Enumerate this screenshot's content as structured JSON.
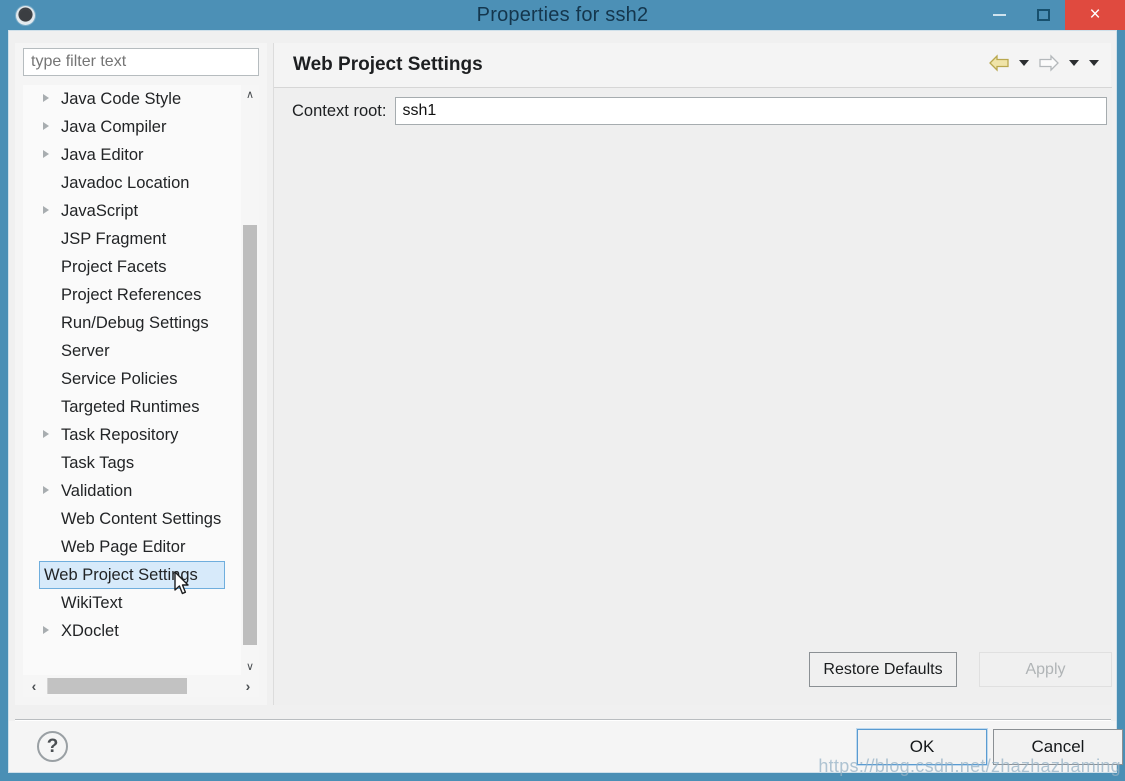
{
  "window": {
    "title": "Properties for ssh2",
    "app_icon": "gear-icon",
    "controls": {
      "minimize": "–",
      "maximize": "□",
      "close": "×"
    }
  },
  "sidebar": {
    "filter_placeholder": "type filter text",
    "filter_value": "",
    "items": [
      {
        "label": "Java Code Style",
        "expandable": true
      },
      {
        "label": "Java Compiler",
        "expandable": true
      },
      {
        "label": "Java Editor",
        "expandable": true
      },
      {
        "label": "Javadoc Location",
        "expandable": false
      },
      {
        "label": "JavaScript",
        "expandable": true
      },
      {
        "label": "JSP Fragment",
        "expandable": false
      },
      {
        "label": "Project Facets",
        "expandable": false
      },
      {
        "label": "Project References",
        "expandable": false
      },
      {
        "label": "Run/Debug Settings",
        "expandable": false
      },
      {
        "label": "Server",
        "expandable": false
      },
      {
        "label": "Service Policies",
        "expandable": false
      },
      {
        "label": "Targeted Runtimes",
        "expandable": false
      },
      {
        "label": "Task Repository",
        "expandable": true
      },
      {
        "label": "Task Tags",
        "expandable": false
      },
      {
        "label": "Validation",
        "expandable": true
      },
      {
        "label": "Web Content Settings",
        "expandable": false
      },
      {
        "label": "Web Page Editor",
        "expandable": false
      },
      {
        "label": "Web Project Settings",
        "expandable": false,
        "selected": true
      },
      {
        "label": "WikiText",
        "expandable": false
      },
      {
        "label": "XDoclet",
        "expandable": true
      }
    ],
    "scroll_up": "∧",
    "scroll_down": "∨",
    "scroll_left": "‹",
    "scroll_right": "›"
  },
  "page": {
    "title": "Web Project Settings",
    "context_root_label": "Context root:",
    "context_root_value": "ssh1",
    "nav": {
      "back_icon": "back-arrow-icon",
      "back_menu_icon": "chevron-down-icon",
      "forward_icon": "forward-arrow-icon",
      "forward_menu_icon": "chevron-down-icon",
      "view_menu_icon": "chevron-down-icon"
    }
  },
  "buttons": {
    "restore_defaults": "Restore Defaults",
    "apply": "Apply",
    "ok": "OK",
    "cancel": "Cancel",
    "help": "?"
  },
  "watermark": "https://blog.csdn.net/zhazhazhaming",
  "colors": {
    "titlebar": "#4c90b6",
    "close_button": "#e04a3f",
    "selection": "#d7eafa",
    "selection_border": "#6faedd",
    "focus_border": "#5a9bd1",
    "back_arrow": "#e8d98f"
  }
}
